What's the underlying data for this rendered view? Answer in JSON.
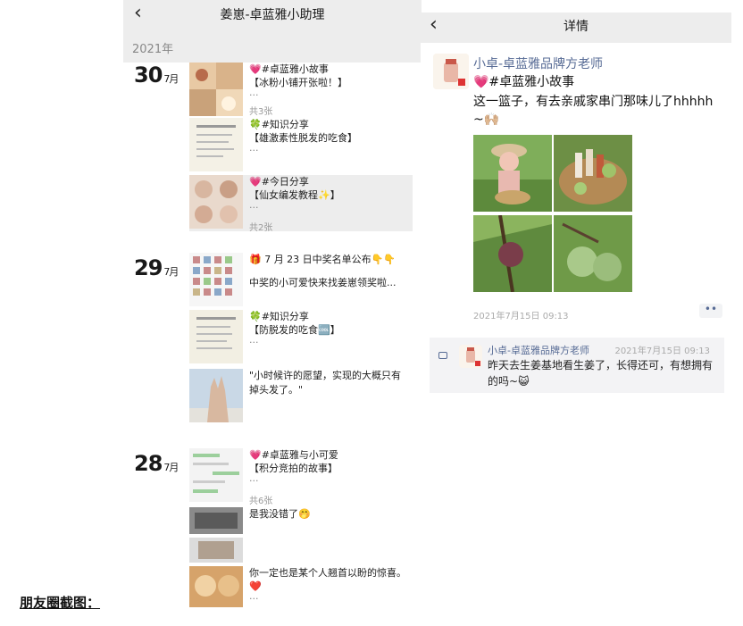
{
  "caption": "朋友圈截图：",
  "left": {
    "title": "姜崽-卓蓝雅小助理",
    "year": "2021年",
    "days": [
      {
        "day": "30",
        "month": "7月",
        "posts": [
          {
            "line1": "💗#卓蓝雅小故事",
            "line2": "【冰粉小铺开张啦！】",
            "count": "共3张"
          },
          {
            "line1": "🍀#知识分享",
            "line2": "【雄激素性脱发的吃食】",
            "count": ""
          },
          {
            "line1": "💗#今日分享",
            "line2": "【仙女编发教程✨】",
            "count": "共2张"
          }
        ]
      },
      {
        "day": "29",
        "month": "7月",
        "posts": [
          {
            "line1": "🎁 7 月 23 日中奖名单公布👇👇",
            "line2": "中奖的小可爱快来找姜崽领奖啦...",
            "count": ""
          },
          {
            "line1": "🍀#知识分享",
            "line2": "【防脱发的吃食🆒】",
            "count": ""
          },
          {
            "line1": "\"小时候许的愿望，实现的大概只有掉头发了。\"",
            "line2": "",
            "count": ""
          }
        ]
      },
      {
        "day": "28",
        "month": "7月",
        "posts": [
          {
            "line1": "💗#卓蓝雅与小可爱",
            "line2": "【积分竞拍的故事】",
            "count": "共6张"
          },
          {
            "line1": "是我没错了🤭",
            "line2": "",
            "count": ""
          },
          {
            "line1": "你一定也是某个人翘首以盼的惊喜。",
            "line2": "❤️",
            "count": ""
          }
        ]
      }
    ]
  },
  "right": {
    "title": "详情",
    "author": "小卓-卓蓝雅品牌方老师",
    "tag_line": "💗#卓蓝雅小故事",
    "body_line1": "这一篮子，有去亲戚家串门那味儿了hhhhh",
    "body_line2": "~🙌🏼",
    "time": "2021年7月15日 09:13",
    "more": "••",
    "comment": {
      "name": "小卓-卓蓝雅品牌方老师",
      "time": "2021年7月15日 09:13",
      "text": "昨天去生姜基地看生姜了，长得还可，有想拥有的吗~😺"
    }
  },
  "colors": {
    "link": "#576b95",
    "header_bg": "#ededed",
    "selected_bg": "#ededed",
    "comment_bg": "#f3f3f5"
  },
  "icons": [
    "back-chevron-icon",
    "comment-icon",
    "more-icon"
  ]
}
